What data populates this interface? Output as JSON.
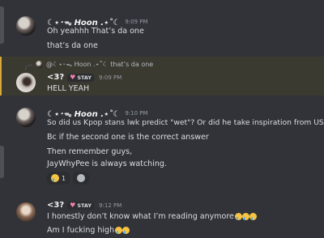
{
  "messages": {
    "m1": {
      "username": "☾⋆･ᯓ Hoon .⋆˚☾",
      "time": "9:09 PM",
      "lines": [
        "Oh yeahhh That’s da one",
        "that’s da one"
      ]
    },
    "m2": {
      "reply_text": "@☾⋆･ᯓ Hoon .⋆˚☾ that’s da one",
      "username": "<3?",
      "badge": "STAY",
      "time": "9:09 PM",
      "lines": [
        "HELL YEAH"
      ]
    },
    "m3": {
      "username": "☾⋆･ᯓ Hoon .⋆˚☾",
      "time": "9:10 PM",
      "lines": [
        "So did us Kpop stans lwk predict \"wet\"? Or did he take inspiration from US??",
        "Bc if the second one is the correct answer",
        "Then remember guys,",
        "JayWhyPee is always watching."
      ],
      "reaction_count": "1"
    },
    "m4": {
      "username": "<3?",
      "badge": "STAY",
      "time": "9:12 PM",
      "lines": [
        "I honestly don’t know what I’m reading anymore",
        "Am I fucking high"
      ]
    }
  },
  "icons": [
    "crying-emoji",
    "add-reaction-icon",
    "heart-badge-icon"
  ]
}
